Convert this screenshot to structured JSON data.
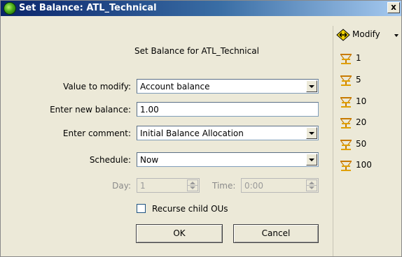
{
  "window": {
    "title": "Set Balance: ATL_Technical",
    "close_label": "x"
  },
  "form": {
    "heading": "Set Balance for ATL_Technical",
    "value_to_modify": {
      "label": "Value to modify:",
      "value": "Account balance"
    },
    "new_balance": {
      "label": "Enter new balance:",
      "value": "1.00"
    },
    "comment": {
      "label": "Enter comment:",
      "value": "Initial Balance Allocation"
    },
    "schedule": {
      "label": "Schedule:",
      "value": "Now"
    },
    "day": {
      "label": "Day:",
      "value": "1",
      "disabled": true
    },
    "time": {
      "label": "Time:",
      "value": "0:00",
      "disabled": true
    },
    "recurse": {
      "label": "Recurse child OUs",
      "checked": false
    }
  },
  "buttons": {
    "ok": "OK",
    "cancel": "Cancel"
  },
  "toolbar": {
    "modify": {
      "label": "Modify",
      "icon": "modify-arrows-icon"
    },
    "presets": [
      {
        "label": "1",
        "icon": "balance-scale-icon"
      },
      {
        "label": "5",
        "icon": "balance-scale-icon"
      },
      {
        "label": "10",
        "icon": "balance-scale-icon"
      },
      {
        "label": "20",
        "icon": "balance-scale-icon"
      },
      {
        "label": "50",
        "icon": "balance-scale-icon"
      },
      {
        "label": "100",
        "icon": "balance-scale-icon"
      }
    ]
  },
  "colors": {
    "titlebar_start": "#0a246a",
    "titlebar_end": "#a6caf0",
    "dialog_bg": "#ece9d8"
  }
}
